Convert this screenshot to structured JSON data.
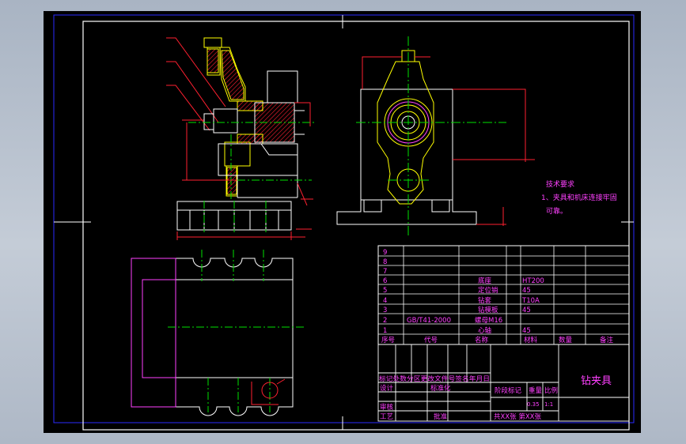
{
  "colors": {
    "background": "#000000",
    "frame": "#ffffff",
    "outline": "#ffffff",
    "hidden": "#ffff00",
    "hatch": "#ff2030",
    "dimension": "#ff2030",
    "center": "#00e000",
    "text": "#ff40ff",
    "viewport": "#2a2aff"
  },
  "tech_requirements": {
    "title": "技术要求",
    "line1": "1、夹具和机床连接牢固",
    "line2": "可靠。"
  },
  "parts_list": {
    "rows": [
      {
        "no": "9",
        "code": "",
        "name": "",
        "qty": "",
        "material": "",
        "mass": "",
        "note": ""
      },
      {
        "no": "8",
        "code": "",
        "name": "",
        "qty": "",
        "material": "",
        "mass": "",
        "note": ""
      },
      {
        "no": "7",
        "code": "",
        "name": "",
        "qty": "",
        "material": "",
        "mass": "",
        "note": ""
      },
      {
        "no": "6",
        "code": "",
        "name": "底座",
        "qty": "",
        "material": "HT200",
        "mass": "",
        "note": ""
      },
      {
        "no": "5",
        "code": "",
        "name": "定位销",
        "qty": "",
        "material": "45",
        "mass": "",
        "note": ""
      },
      {
        "no": "4",
        "code": "",
        "name": "钻套",
        "qty": "",
        "material": "T10A",
        "mass": "",
        "note": ""
      },
      {
        "no": "3",
        "code": "",
        "name": "钻模板",
        "qty": "",
        "material": "45",
        "mass": "",
        "note": ""
      },
      {
        "no": "2",
        "code": "GB/T41-2000",
        "name": "螺母M16",
        "qty": "",
        "material": "",
        "mass": "",
        "note": ""
      },
      {
        "no": "1",
        "code": "",
        "name": "心轴",
        "qty": "",
        "material": "45",
        "mass": "",
        "note": ""
      }
    ],
    "header": {
      "no": "序号",
      "code": "代号",
      "name": "名称",
      "qty": "数量",
      "material": "材料",
      "mass": "重量",
      "note": "备注"
    }
  },
  "title_block": {
    "title": "钻夹具",
    "revision_row": "标记处数分区更改文件号签名年月日",
    "design": "设计",
    "standardize": "标准化",
    "review": "审核",
    "process": "工艺",
    "approve": "批准",
    "stage_mark": "阶段标记",
    "weight": "重量",
    "scale": "比例",
    "weight_value": "0.35",
    "scale_value": "1:1",
    "sheet": "共XX张 第XX张"
  }
}
